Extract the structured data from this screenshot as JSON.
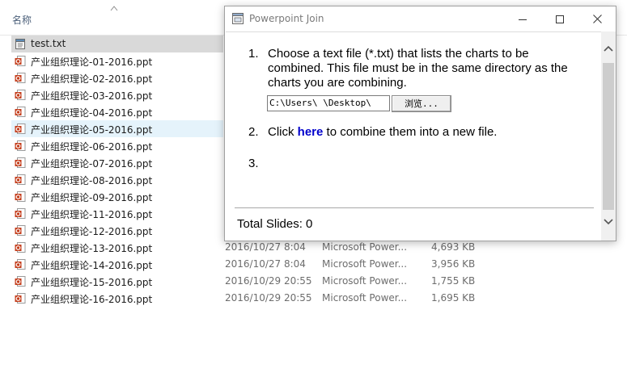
{
  "explorer": {
    "column_name": "名称",
    "files": [
      {
        "name": "test.txt",
        "type": "txt",
        "state": "selected"
      },
      {
        "name": "产业组织理论-01-2016.ppt",
        "type": "ppt"
      },
      {
        "name": "产业组织理论-02-2016.ppt",
        "type": "ppt"
      },
      {
        "name": "产业组织理论-03-2016.ppt",
        "type": "ppt"
      },
      {
        "name": "产业组织理论-04-2016.ppt",
        "type": "ppt"
      },
      {
        "name": "产业组织理论-05-2016.ppt",
        "type": "ppt",
        "state": "hover"
      },
      {
        "name": "产业组织理论-06-2016.ppt",
        "type": "ppt"
      },
      {
        "name": "产业组织理论-07-2016.ppt",
        "type": "ppt"
      },
      {
        "name": "产业组织理论-08-2016.ppt",
        "type": "ppt"
      },
      {
        "name": "产业组织理论-09-2016.ppt",
        "type": "ppt"
      },
      {
        "name": "产业组织理论-11-2016.ppt",
        "type": "ppt"
      },
      {
        "name": "产业组织理论-12-2016.ppt",
        "type": "ppt"
      },
      {
        "name": "产业组织理论-13-2016.ppt",
        "type": "ppt",
        "date": "2016/10/27 8:04",
        "app": "Microsoft Power...",
        "size": "4,693 KB"
      },
      {
        "name": "产业组织理论-14-2016.ppt",
        "type": "ppt",
        "date": "2016/10/27 8:04",
        "app": "Microsoft Power...",
        "size": "3,956 KB"
      },
      {
        "name": "产业组织理论-15-2016.ppt",
        "type": "ppt",
        "date": "2016/10/29 20:55",
        "app": "Microsoft Power...",
        "size": "1,755 KB"
      },
      {
        "name": "产业组织理论-16-2016.ppt",
        "type": "ppt",
        "date": "2016/10/29 20:55",
        "app": "Microsoft Power...",
        "size": "1,695 KB"
      }
    ]
  },
  "dialog": {
    "title": "Powerpoint Join",
    "step1": {
      "number": "1.",
      "line1": "Choose a text file (*.txt) that lists the charts to be",
      "line2": "combined. This file must be in the same directory as the",
      "line3": "charts you are combining.",
      "path_value": "C:\\Users\\    \\Desktop\\",
      "browse_label": "浏览..."
    },
    "step2": {
      "number": "2.",
      "prefix": "Click ",
      "link": "here",
      "suffix": " to combine them into a new file."
    },
    "step3": {
      "number": "3."
    },
    "total_label": "Total Slides: 0"
  },
  "colors": {
    "link": "#0000cc",
    "selected_row": "#d9d9d9",
    "hover_row": "#e5f3fb",
    "ppt_icon": "#c43e1c"
  }
}
